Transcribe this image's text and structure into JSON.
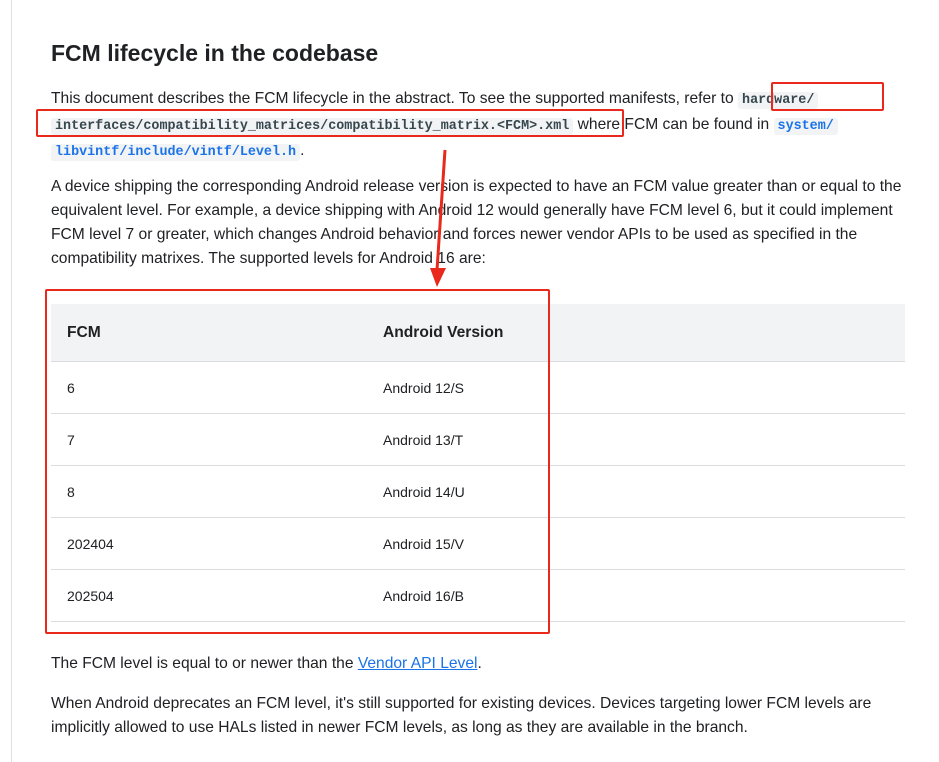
{
  "heading": "FCM lifecycle in the codebase",
  "para1": {
    "text_a": "This document describes the FCM lifecycle in the abstract. To see the supported manifests, refer to ",
    "code_a1": "hardware/",
    "code_a2": "interfaces/compatibility_matrices/compatibility_matrix.<FCM>.xml",
    "text_b": " where FCM can be found in ",
    "code_b1": "system/",
    "code_b2": "libvintf/include/vintf/Level.h",
    "text_c": "."
  },
  "para2": "A device shipping the corresponding Android release version is expected to have an FCM value greater than or equal to the equivalent level. For example, a device shipping with Android 12 would generally have FCM level 6, but it could implement FCM level 7 or greater, which changes Android behavior and forces newer vendor APIs to be used as specified in the compatibility matrixes. The supported levels for Android 16 are:",
  "table": {
    "headers": [
      "FCM",
      "Android Version"
    ],
    "rows": [
      [
        "6",
        "Android 12/S"
      ],
      [
        "7",
        "Android 13/T"
      ],
      [
        "8",
        "Android 14/U"
      ],
      [
        "202404",
        "Android 15/V"
      ],
      [
        "202504",
        "Android 16/B"
      ]
    ]
  },
  "para3": {
    "text_a": "The FCM level is equal to or newer than the ",
    "link": "Vendor API Level",
    "text_b": "."
  },
  "para4": "When Android deprecates an FCM level, it's still supported for existing devices. Devices targeting lower FCM levels are implicitly allowed to use HALs listed in newer FCM levels, as long as they are available in the branch.",
  "annotation_color": "#e8291c"
}
